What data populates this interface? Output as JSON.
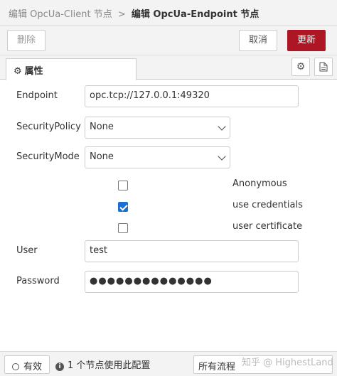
{
  "breadcrumb": {
    "parent": "编辑 OpcUa-Client 节点",
    "separator": ">",
    "current": "编辑 OpcUa-Endpoint 节点"
  },
  "toolbar": {
    "delete_label": "删除",
    "cancel_label": "取消",
    "update_label": "更新"
  },
  "tabs": {
    "properties_label": "属性",
    "properties_icon": "gear-icon",
    "gear_icon": "gear-icon",
    "doc_icon": "document-icon"
  },
  "form": {
    "endpoint": {
      "label": "Endpoint",
      "value": "opc.tcp://127.0.0.1:49320"
    },
    "security_policy": {
      "label": "SecurityPolicy",
      "value": "None"
    },
    "security_mode": {
      "label": "SecurityMode",
      "value": "None"
    },
    "auth_options": [
      {
        "label": "Anonymous",
        "checked": false
      },
      {
        "label": "use credentials",
        "checked": true
      },
      {
        "label": "user certificate",
        "checked": false
      }
    ],
    "user": {
      "label": "User",
      "value": "test"
    },
    "password": {
      "label": "Password",
      "value": "●●●●●●●●●●●●●●"
    }
  },
  "footer": {
    "toggle_label": "有效",
    "usage_text": "1 个节点使用此配置",
    "scope_label": "所有流程",
    "watermark": "知乎 @ HighestLand"
  },
  "colors": {
    "update_button": "#ad1625",
    "checkbox_checked": "#1a6fd1"
  }
}
